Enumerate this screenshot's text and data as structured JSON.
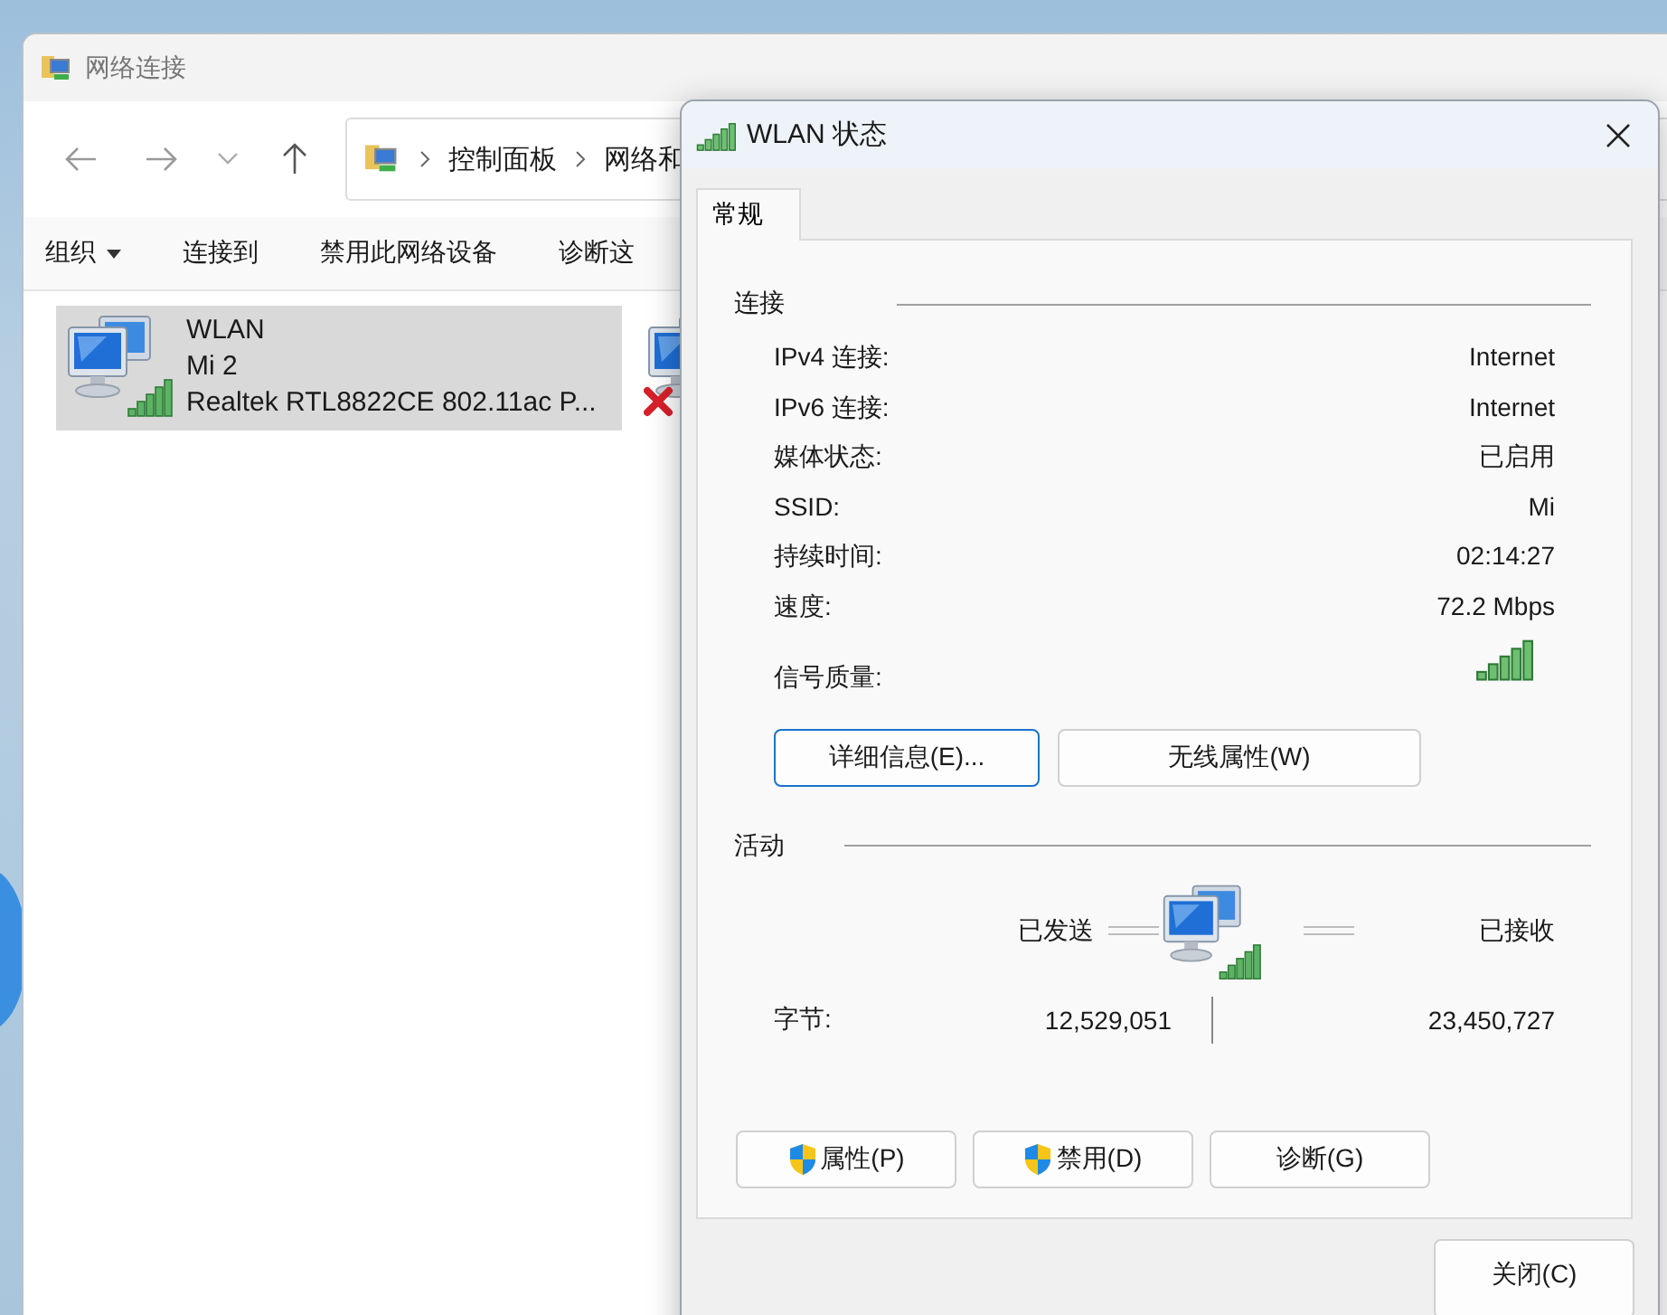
{
  "explorer": {
    "title": "网络连接",
    "address": {
      "segments": [
        "控制面板",
        "网络和"
      ]
    },
    "commands": [
      {
        "label": "组织",
        "kind": "menu"
      },
      {
        "label": "连接到",
        "kind": "plain"
      },
      {
        "label": "禁用此网络设备",
        "kind": "plain"
      },
      {
        "label": "诊断这",
        "kind": "plain"
      }
    ],
    "connections": [
      {
        "name": "WLAN",
        "network": "Mi 2",
        "device": "Realtek RTL8822CE 802.11ac P...",
        "selected": true,
        "connected": true
      },
      {
        "selected": false,
        "connected": false
      }
    ]
  },
  "dialog": {
    "title": "WLAN 状态",
    "tabs": [
      {
        "label": "常规",
        "selected": true
      }
    ],
    "connection": {
      "heading": "连接",
      "rows": [
        {
          "kind": "text",
          "label": "IPv4 连接:",
          "value": "Internet"
        },
        {
          "kind": "text",
          "label": "IPv6 连接:",
          "value": "Internet"
        },
        {
          "kind": "text",
          "label": "媒体状态:",
          "value": "已启用"
        },
        {
          "kind": "text",
          "label": "SSID:",
          "value": "Mi"
        },
        {
          "kind": "text",
          "label": "持续时间:",
          "value": "02:14:27"
        },
        {
          "kind": "text",
          "label": "速度:",
          "value": "72.2 Mbps"
        },
        {
          "kind": "signal",
          "label": "信号质量:"
        }
      ]
    },
    "buttons": [
      {
        "label": "详细信息(E)...",
        "focused": true
      },
      {
        "label": "无线属性(W)",
        "focused": false
      }
    ],
    "activity": {
      "heading": "活动",
      "sent_label": "已发送",
      "received_label": "已接收",
      "bytes_label": "字节:",
      "sent": "12,529,051",
      "received": "23,450,727"
    },
    "action_buttons": [
      {
        "label": "属性(P)",
        "shield": true
      },
      {
        "label": "禁用(D)",
        "shield": true
      },
      {
        "label": "诊断(G)",
        "shield": false
      }
    ],
    "close_button": "关闭(C)"
  }
}
